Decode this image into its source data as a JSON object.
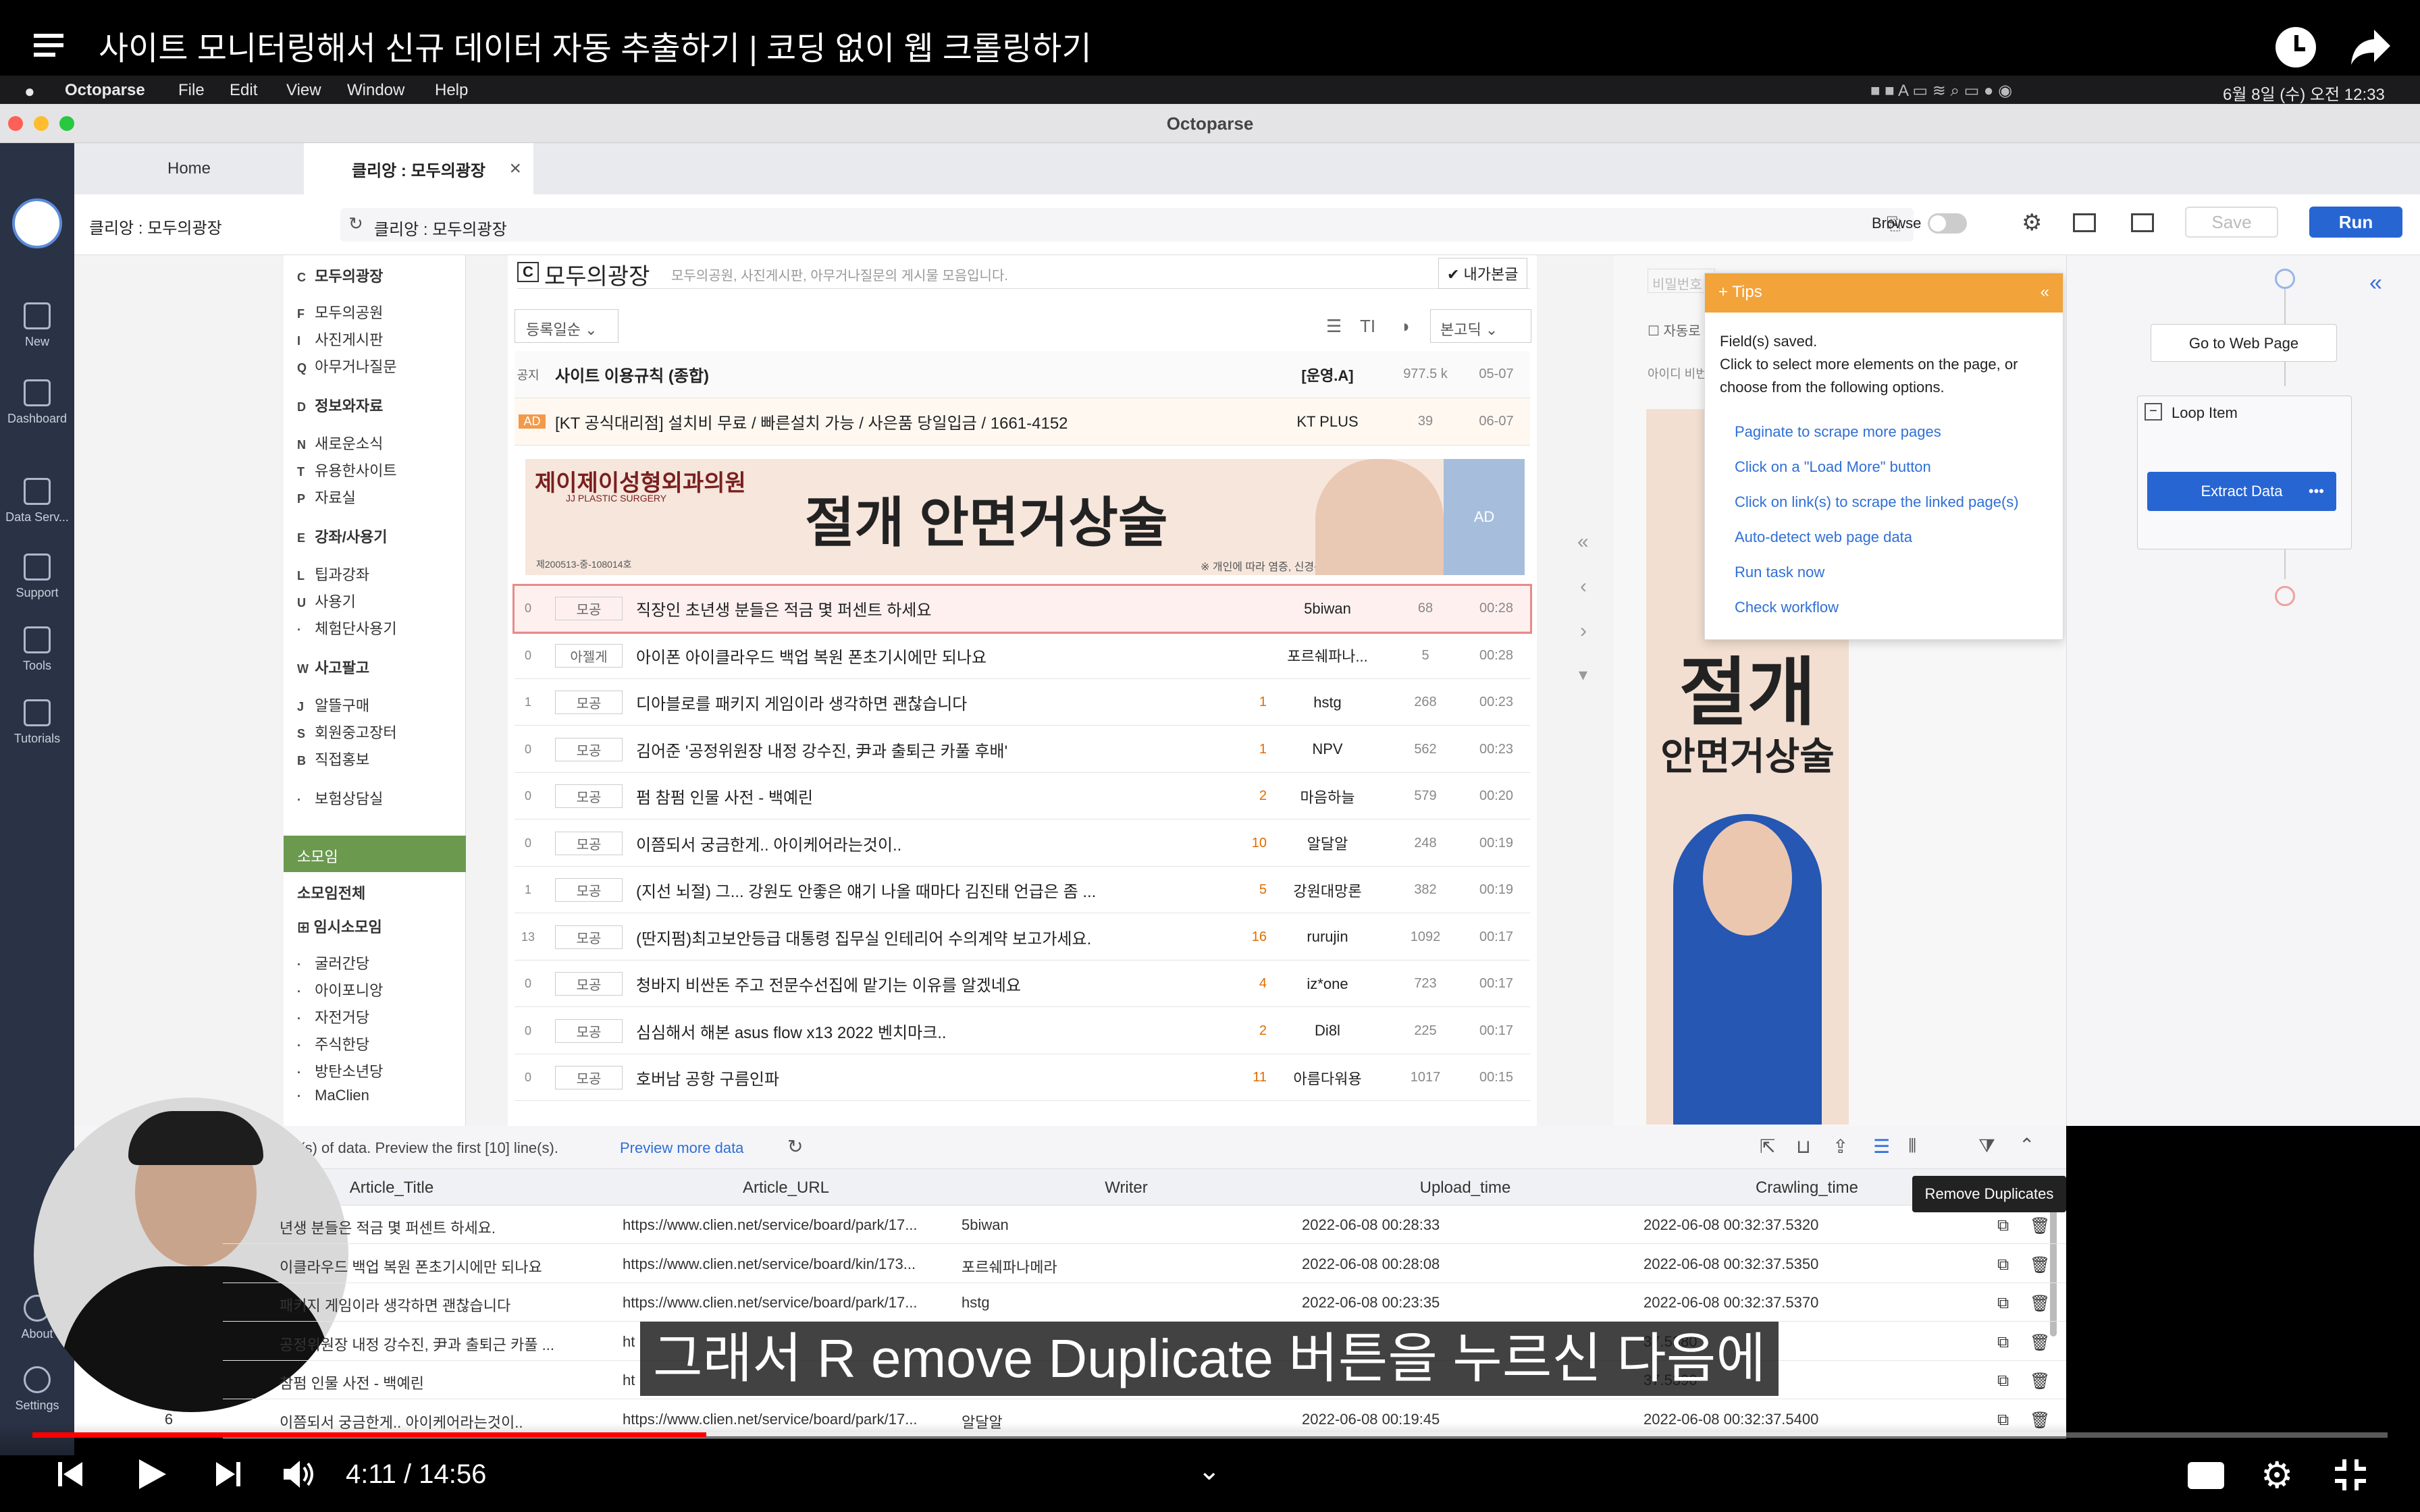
{
  "video": {
    "title": "사이트 모니터링해서 신규 데이터 자동 추출하기 | 코딩 없이 웹 크롤링하기",
    "caption": "그래서 R emove Duplicate 버튼을 누르신 다음에",
    "time_current": "4:11",
    "time_sep": " / ",
    "time_total": "14:56",
    "progress": 0.286
  },
  "menubar": {
    "app": "Octoparse",
    "items": [
      "File",
      "Edit",
      "View",
      "Window",
      "Help"
    ],
    "clock": "6월 8일 (수) 오전 12:33"
  },
  "window": {
    "title": "Octoparse",
    "tabs": [
      {
        "label": "Home",
        "active": false
      },
      {
        "label": "클리앙 : 모두의광장",
        "active": true
      }
    ],
    "breadcrumb": "클리앙 : 모두의광장",
    "url": "클리앙 : 모두의광장",
    "browse_label": "Browse",
    "save_label": "Save",
    "run_label": "Run"
  },
  "rail": {
    "items": [
      "New",
      "Dashboard",
      "Data Serv...",
      "Support",
      "Tools",
      "Tutorials",
      "About",
      "Settings"
    ]
  },
  "site": {
    "nav": [
      {
        "key": "C",
        "label": "모두의광장"
      },
      {
        "key": "F",
        "label": "모두의공원"
      },
      {
        "key": "I",
        "label": "사진게시판"
      },
      {
        "key": "Q",
        "label": "아무거나질문"
      },
      {
        "key": "D",
        "label": "정보와자료"
      },
      {
        "key": "N",
        "label": "새로운소식"
      },
      {
        "key": "T",
        "label": "유용한사이트"
      },
      {
        "key": "P",
        "label": "자료실"
      },
      {
        "key": "E",
        "label": "강좌/사용기"
      },
      {
        "key": "L",
        "label": "팁과강좌"
      },
      {
        "key": "U",
        "label": "사용기"
      },
      {
        "key": "·",
        "label": "체험단사용기"
      },
      {
        "key": "W",
        "label": "사고팔고"
      },
      {
        "key": "J",
        "label": "알뜰구매"
      },
      {
        "key": "S",
        "label": "회원중고장터"
      },
      {
        "key": "B",
        "label": "직접홍보"
      },
      {
        "key": "·",
        "label": "보험상담실"
      }
    ],
    "somoim_header": "소모임",
    "somoim_all": "소모임전체",
    "somoim_sub": "임시소모임",
    "somoim_items": [
      "굴러간당",
      "아이포니앙",
      "자전거당",
      "주식한당",
      "방탄소년당",
      "MaClien"
    ],
    "board_key": "C",
    "board_title": "모두의광장",
    "board_desc": "모두의공원, 사진게시판, 아무거나질문의 게시물 모음입니다.",
    "my_posts_label": "내가본글",
    "sort_label": "등록일순",
    "filter_label": "본고딕",
    "notice": {
      "tag": "공지",
      "title": "사이트 이용규칙 (종합)",
      "writer": "[운영.A]",
      "hits": "977.5 k",
      "time": "05-07"
    },
    "ad_row": {
      "tag": "AD",
      "title": "[KT 공식대리점] 설치비 무료 / 빠른설치 가능 / 사은품 당일입금 / 1661-4152",
      "writer": "KT PLUS",
      "hits": "39",
      "time": "06-07"
    },
    "banner": {
      "clinic": "제이제이성형외과의원",
      "clinic_en": "JJ PLASTIC SURGERY",
      "headline": "절개 안면거상술",
      "note": "※ 개인에 따라 염증, 신경손상, 출혈 등 부작용",
      "reg": "제200513-중-108014호",
      "ad": "AD"
    },
    "posts": [
      {
        "n": "0",
        "cat": "모공",
        "title": "직장인 초년생 분들은 적금 몇 퍼센트 하세요",
        "comments": "",
        "writer": "5biwan",
        "hits": "68",
        "time": "00:28"
      },
      {
        "n": "0",
        "cat": "아젤게",
        "title": "아이폰 아이클라우드 백업 복원 폰초기시에만 되나요",
        "comments": "",
        "writer": "포르쉐파나...",
        "hits": "5",
        "time": "00:28"
      },
      {
        "n": "1",
        "cat": "모공",
        "title": "디아블로를 패키지 게임이라 생각하면 괜찮습니다",
        "comments": "1",
        "writer": "hstg",
        "hits": "268",
        "time": "00:23"
      },
      {
        "n": "0",
        "cat": "모공",
        "title": "김어준 '공정위원장 내정 강수진, 尹과 출퇴근 카풀 후배'",
        "comments": "1",
        "writer": "NPV",
        "hits": "562",
        "time": "00:23"
      },
      {
        "n": "0",
        "cat": "모공",
        "title": "펌 참펌 인물 사전 - 백예린",
        "comments": "2",
        "writer": "마음하늘",
        "hits": "579",
        "time": "00:20"
      },
      {
        "n": "0",
        "cat": "모공",
        "title": "이쯤되서 궁금한게.. 아이케어라는것이..",
        "comments": "10",
        "writer": "알달알",
        "hits": "248",
        "time": "00:19"
      },
      {
        "n": "1",
        "cat": "모공",
        "title": "(지선 뇌절) 그... 강원도 안좋은 얘기 나올 때마다 김진태 언급은 좀 ...",
        "comments": "5",
        "writer": "강원대망론",
        "hits": "382",
        "time": "00:19"
      },
      {
        "n": "13",
        "cat": "모공",
        "title": "(딴지펌)최고보안등급 대통령 집무실 인테리어 수의계약 보고가세요.",
        "comments": "16",
        "writer": "rurujin",
        "hits": "1092",
        "time": "00:17"
      },
      {
        "n": "0",
        "cat": "모공",
        "title": "청바지 비싼돈 주고 전문수선집에 맡기는 이유를 알겠네요",
        "comments": "4",
        "writer": "iz*one",
        "hits": "723",
        "time": "00:17"
      },
      {
        "n": "0",
        "cat": "모공",
        "title": "심심해서 해본 asus flow x13 2022 벤치마크..",
        "comments": "2",
        "writer": "Di8l",
        "hits": "225",
        "time": "00:17"
      },
      {
        "n": "0",
        "cat": "모공",
        "title": "호버남 공항 구름인파",
        "comments": "11",
        "writer": "아름다워용",
        "hits": "1017",
        "time": "00:15"
      }
    ],
    "login_placeholder": "비밀번호",
    "auto_login": "자동로",
    "id_find": "아이디 비번"
  },
  "tips": {
    "header": "Tips",
    "line1": "Field(s) saved.",
    "line2": "Click to select more elements on the page, or",
    "line3": "choose from the following options.",
    "links": [
      "Paginate to scrape more pages",
      "Click on a \"Load More\" button",
      "Click on link(s) to scrape the linked page(s)",
      "Auto-detect web page data",
      "Run task now",
      "Check workflow"
    ]
  },
  "workflow": {
    "go_to_page": "Go to Web Page",
    "loop_item": "Loop Item",
    "extract_data": "Extract Data",
    "more": "•••"
  },
  "preview": {
    "info": "line(s) of data. Preview the first [10] line(s).",
    "more_link": "Preview more data",
    "tooltip": "Remove Duplicates",
    "columns": [
      "Article_Title",
      "Article_URL",
      "Writer",
      "Upload_time",
      "Crawling_time"
    ],
    "rows": [
      {
        "idx": "",
        "title": "년생 분들은 적금 몇 퍼센트 하세요.",
        "url": "https://www.clien.net/service/board/park/17...",
        "writer": "5biwan",
        "upload": "2022-06-08 00:28:33",
        "crawl": "2022-06-08 00:32:37.5320"
      },
      {
        "idx": "",
        "title": "이클라우드 백업 복원 폰초기시에만 되나요",
        "url": "https://www.clien.net/service/board/kin/173...",
        "writer": "포르쉐파나메라",
        "upload": "2022-06-08 00:28:08",
        "crawl": "2022-06-08 00:32:37.5350"
      },
      {
        "idx": "",
        "title": "패키지 게임이라 생각하면 괜찮습니다",
        "url": "https://www.clien.net/service/board/park/17...",
        "writer": "hstg",
        "upload": "2022-06-08 00:23:35",
        "crawl": "2022-06-08 00:32:37.5370"
      },
      {
        "idx": "",
        "title": "공정위원장 내정 강수진, 尹과 출퇴근 카풀 ...",
        "url": "ht",
        "writer": "",
        "upload": "",
        "crawl": "37.5380"
      },
      {
        "idx": "",
        "title": "참펌 인물 사전 - 백예린",
        "url": "ht",
        "writer": "",
        "upload": "",
        "crawl": "37.5390"
      },
      {
        "idx": "6",
        "title": "이쯤되서 궁금한게.. 아이케어라는것이..",
        "url": "https://www.clien.net/service/board/park/17...",
        "writer": "알달알",
        "upload": "2022-06-08 00:19:45",
        "crawl": "2022-06-08 00:32:37.5400"
      }
    ]
  }
}
